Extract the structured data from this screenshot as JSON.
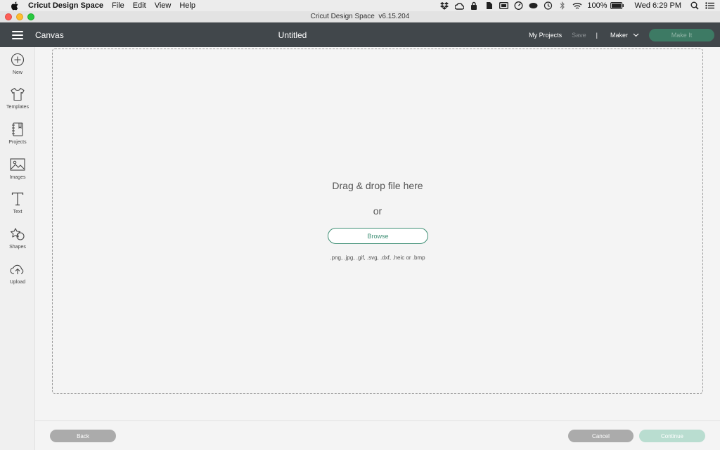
{
  "menubar": {
    "app_name": "Cricut Design Space",
    "menus": [
      "File",
      "Edit",
      "View",
      "Help"
    ],
    "battery": "100%",
    "clock": "Wed 6:29 PM"
  },
  "window": {
    "title": "Cricut Design Space  v6.15.204"
  },
  "header": {
    "section": "Canvas",
    "doc_title": "Untitled",
    "my_projects": "My Projects",
    "save": "Save",
    "separator": "|",
    "machine": "Maker",
    "make_it": "Make It"
  },
  "sidebar": {
    "items": [
      {
        "label": "New",
        "icon": "plus-circle-icon"
      },
      {
        "label": "Templates",
        "icon": "tshirt-icon"
      },
      {
        "label": "Projects",
        "icon": "notebook-icon"
      },
      {
        "label": "Images",
        "icon": "image-icon"
      },
      {
        "label": "Text",
        "icon": "text-icon"
      },
      {
        "label": "Shapes",
        "icon": "shapes-icon"
      },
      {
        "label": "Upload",
        "icon": "cloud-upload-icon"
      }
    ]
  },
  "upload": {
    "drag_text": "Drag & drop file here",
    "or_text": "or",
    "browse": "Browse",
    "formats": ".png, .jpg, .gif, .svg, .dxf, .heic or .bmp"
  },
  "footer": {
    "back": "Back",
    "cancel": "Cancel",
    "continue": "Continue"
  },
  "colors": {
    "header_bg": "#41474b",
    "accent_green": "#3f8f75",
    "make_it_bg": "#3d7a64",
    "continue_bg": "#b9ddd0"
  }
}
